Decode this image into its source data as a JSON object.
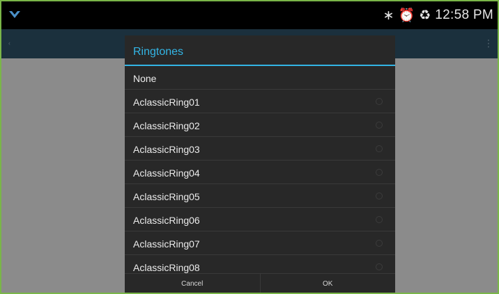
{
  "status_bar": {
    "icons": [
      "bluetooth-icon",
      "alarm-icon",
      "sync-icon"
    ],
    "bluetooth_glyph": "∗",
    "alarm_glyph": "⏰",
    "sync_glyph": "♻",
    "time": "12:58 PM"
  },
  "dialog": {
    "title": "Ringtones",
    "items": [
      {
        "label": "None"
      },
      {
        "label": "AclassicRing01"
      },
      {
        "label": "AclassicRing02"
      },
      {
        "label": "AclassicRing03"
      },
      {
        "label": "AclassicRing04"
      },
      {
        "label": "AclassicRing05"
      },
      {
        "label": "AclassicRing06"
      },
      {
        "label": "AclassicRing07"
      },
      {
        "label": "AclassicRing08"
      }
    ],
    "cancel_label": "Cancel",
    "ok_label": "OK"
  },
  "colors": {
    "accent": "#33b5e5",
    "dialog_bg": "#282828",
    "frame_border": "#7ab648"
  }
}
